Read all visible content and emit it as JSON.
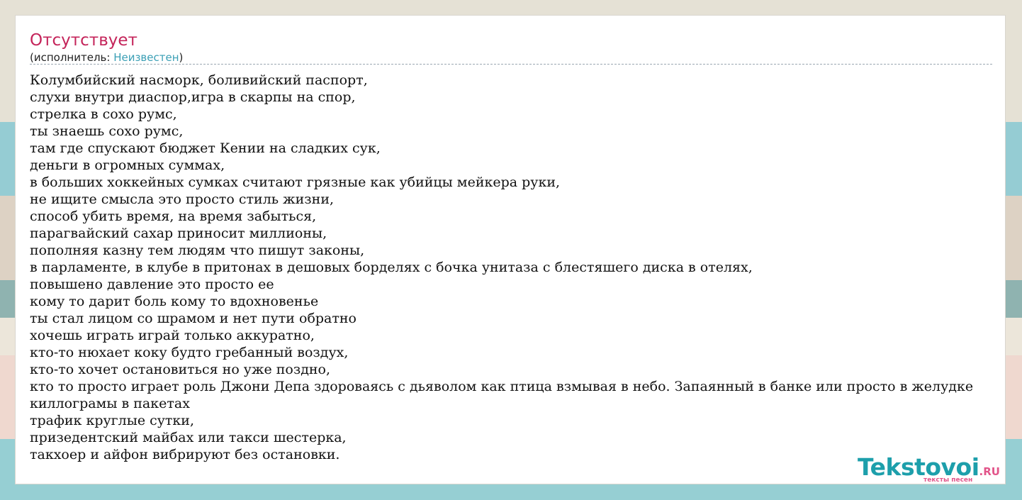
{
  "song": {
    "title": "Отсутствует",
    "performer_prefix": "(исполнитель: ",
    "performer_name": "Неизвестен",
    "performer_suffix": ")"
  },
  "lyrics": [
    "Колумбийский насморк, боливийский паспорт,",
    "слухи внутри диаспор,игра в скарпы на спор,",
    "стрелка в сохо румс,",
    "ты знаешь сохо румс,",
    "там где спускают бюджет Кении на сладких сук,",
    "деньги в огромных суммах,",
    "в больших хоккейных сумках считают грязные как убийцы мейкера руки,",
    "не ищите смысла это просто стиль жизни,",
    "способ убить время, на время забыться,",
    "парагвайский сахар приносит миллионы,",
    "пополняя казну тем людям что пишут законы,",
    "в парламенте, в клубе в притонах в дешовых борделях с бочка унитаза с блестяшего диска в отелях,",
    "повышено давление это просто ее",
    "кому то дарит боль кому то вдохновенье",
    "ты стал лицом со шрамом и нет пути обратно",
    "хочешь играть играй только аккуратно,",
    "кто-то нюхает коку будто гребанный воздух,",
    "кто-то хочет остановиться но уже поздно,",
    "кто то просто играет роль Джони Депа здороваясь с дьяволом как птица взмывая в небо. Запаянный в банке или просто в желудке",
    "киллограмы в пакетах",
    "трафик круглые сутки,",
    "призедентский майбах или такси шестерка,",
    "такхоер и айфон вибрируют без остановки."
  ],
  "logo": {
    "name": "Tekstovoi",
    "tld": ".RU",
    "tagline": "тексты песен"
  },
  "colors": {
    "title": "#c4245a",
    "performer_link": "#3a9fb5",
    "logo_main": "#1d9fab",
    "logo_accent": "#e2558a"
  }
}
